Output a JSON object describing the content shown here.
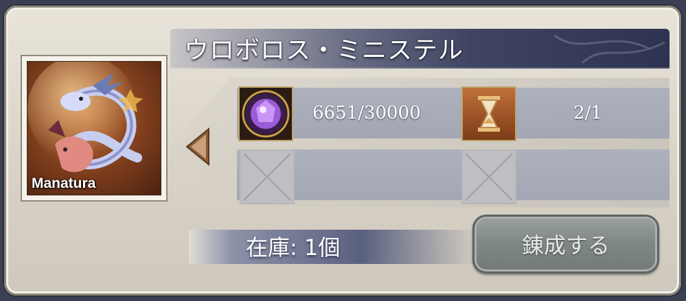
{
  "item": {
    "title": "ウロボロス・ミニステル",
    "portrait_label": "Manatura"
  },
  "materials": [
    {
      "icon": "purple-gem-icon",
      "amount": "6651/30000"
    },
    {
      "icon": "hourglass-icon",
      "amount": "2/1"
    },
    {
      "icon": "empty-slot-icon",
      "amount": ""
    },
    {
      "icon": "empty-slot-icon",
      "amount": ""
    }
  ],
  "stock_label": "在庫: 1個",
  "craft_button": "錬成する"
}
